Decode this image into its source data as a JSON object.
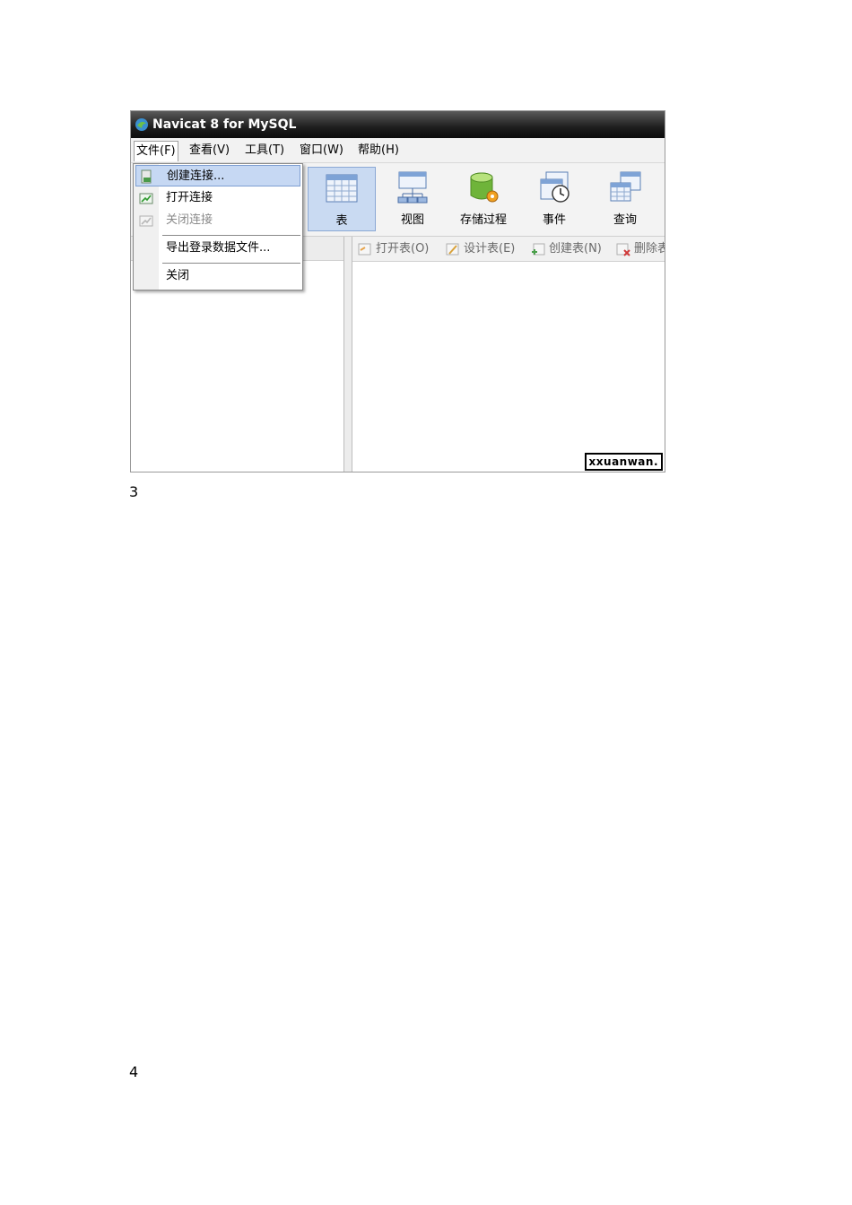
{
  "window": {
    "title": "Navicat 8 for MySQL"
  },
  "menu": {
    "items": [
      "文件(F)",
      "查看(V)",
      "工具(T)",
      "窗口(W)",
      "帮助(H)"
    ]
  },
  "file_menu": {
    "items": [
      "创建连接...",
      "打开连接",
      "关闭连接",
      "导出登录数据文件...",
      "关闭"
    ]
  },
  "toolbar": {
    "buttons": [
      "表",
      "视图",
      "存储过程",
      "事件",
      "查询"
    ]
  },
  "subtoolbar": {
    "buttons": [
      "打开表(O)",
      "设计表(E)",
      "创建表(N)",
      "删除表"
    ]
  },
  "watermark": "xxuanwan.",
  "page_numbers": [
    "3",
    "4"
  ],
  "colors": {
    "highlight": "#c6d8f3",
    "titlebar": "#1e1e1e"
  }
}
